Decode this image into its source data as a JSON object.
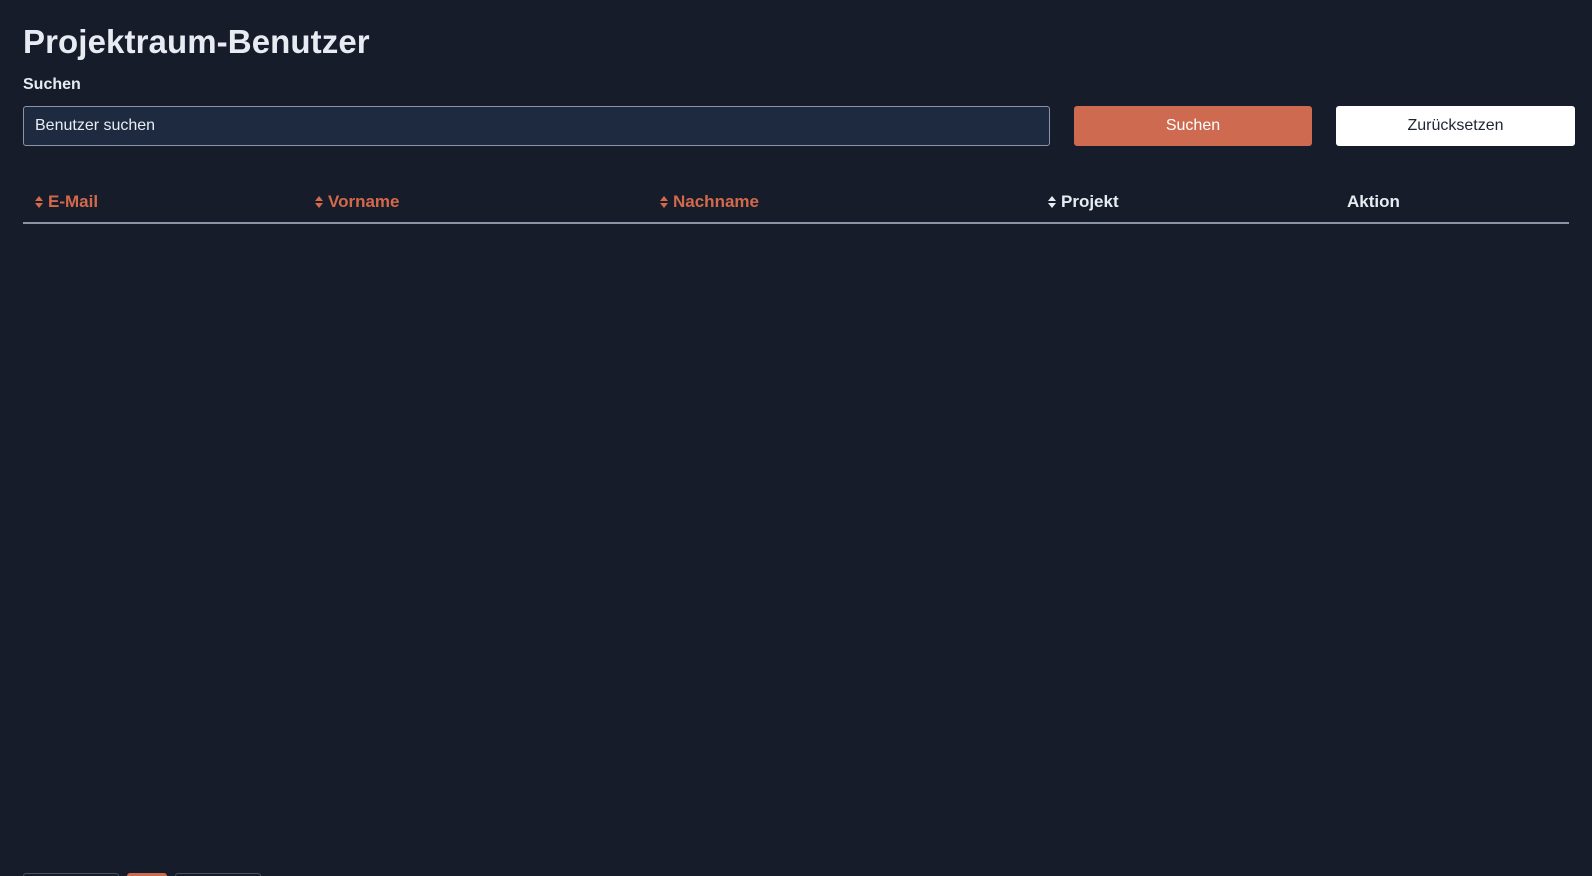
{
  "page": {
    "title": "Projektraum-Benutzer"
  },
  "search": {
    "label": "Suchen",
    "placeholder": "Benutzer suchen",
    "value": "",
    "search_button_label": "Suchen",
    "reset_button_label": "Zurücksetzen"
  },
  "table": {
    "columns": [
      {
        "label": "E-Mail",
        "sortable": true,
        "color": "#d3694b"
      },
      {
        "label": "Vorname",
        "sortable": true,
        "color": "#d3694b"
      },
      {
        "label": "Nachname",
        "sortable": true,
        "color": "#d3694b"
      },
      {
        "label": "Projekt",
        "sortable": true,
        "color": "#e8ecf2"
      },
      {
        "label": "Aktion",
        "sortable": false,
        "color": "#e8ecf2"
      }
    ],
    "rows": []
  },
  "colors": {
    "background": "#161c2a",
    "accent": "#cd6a4f",
    "text": "#e8ecf2",
    "input_background": "#1e2a40"
  },
  "icons": {
    "sort": "sort-icon"
  }
}
